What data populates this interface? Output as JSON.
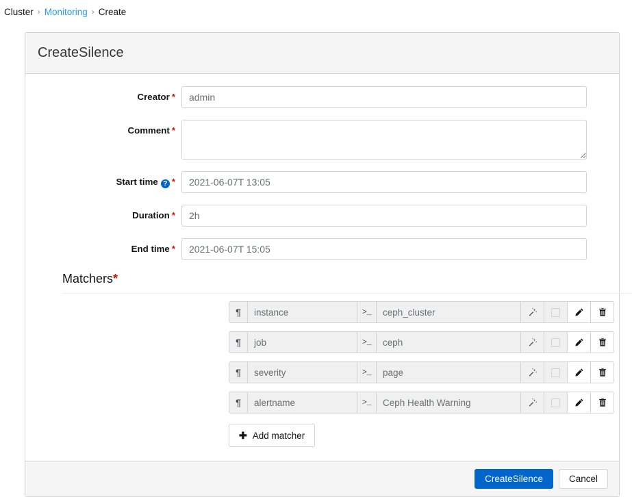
{
  "breadcrumb": {
    "items": [
      {
        "label": "Cluster",
        "link": false
      },
      {
        "label": "Monitoring",
        "link": true
      },
      {
        "label": "Create",
        "link": false
      }
    ],
    "separator": "›"
  },
  "card": {
    "title": "CreateSilence"
  },
  "form": {
    "creator": {
      "label": "Creator",
      "required": "*",
      "value": "admin",
      "placeholder": "admin"
    },
    "comment": {
      "label": "Comment",
      "required": "*",
      "value": "",
      "placeholder": ""
    },
    "start_time": {
      "label": "Start time",
      "required": "*",
      "help_icon": "question-circle-icon",
      "help_glyph": "?",
      "value": "2021-06-07T 13:05",
      "placeholder": "2021-06-07T 13:05"
    },
    "duration": {
      "label": "Duration",
      "required": "*",
      "value": "2h",
      "placeholder": "2h"
    },
    "end_time": {
      "label": "End time",
      "required": "*",
      "value": "2021-06-07T 15:05",
      "placeholder": "2021-06-07T 15:05"
    }
  },
  "matchers": {
    "title": "Matchers",
    "required": "*",
    "pilcrow_glyph": "¶",
    "terminal_glyph": ">_",
    "rows": [
      {
        "name": "instance",
        "value": "ceph_cluster"
      },
      {
        "name": "job",
        "value": "ceph"
      },
      {
        "name": "severity",
        "value": "page"
      },
      {
        "name": "alertname",
        "value": "Ceph Health Warning"
      }
    ],
    "add_button": {
      "label": "Add matcher",
      "icon": "plus-icon",
      "glyph": "✚"
    }
  },
  "footer": {
    "submit_label": "CreateSilence",
    "cancel_label": "Cancel"
  },
  "colors": {
    "link": "#2b9af3",
    "primary": "#0066cc",
    "required": "#c9190b",
    "header_bg": "#f5f5f5",
    "border": "#d2d2d2",
    "addon_bg": "#f0f0f0",
    "muted_text": "#6a6e73"
  }
}
